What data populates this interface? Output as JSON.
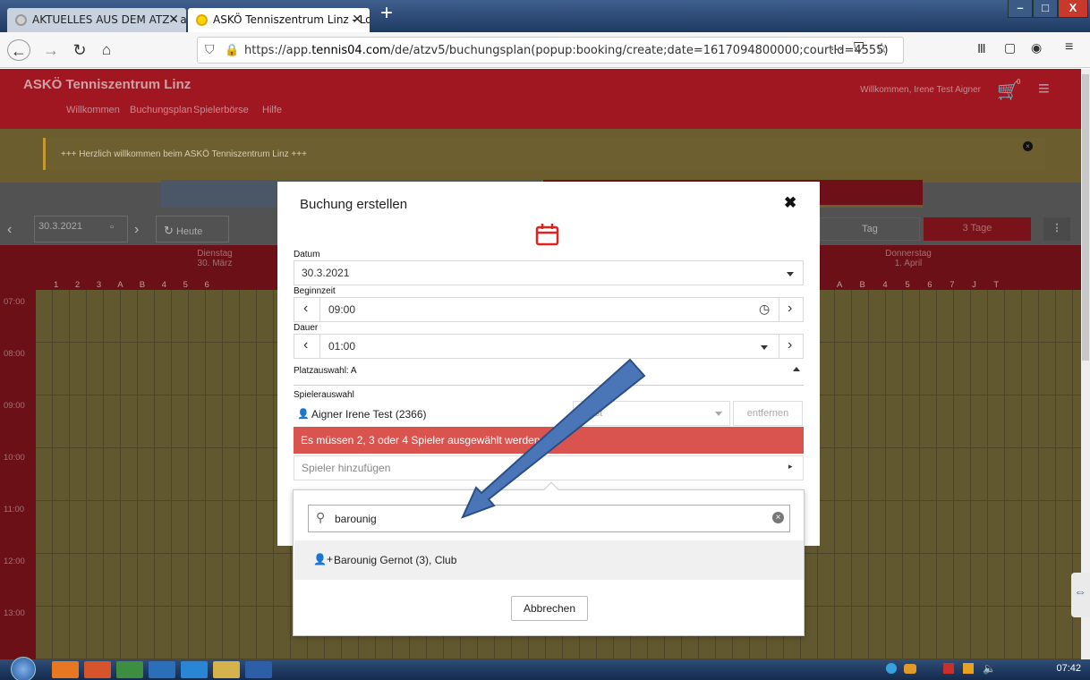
{
  "browser": {
    "tabs": [
      {
        "label": "AKTUELLES AUS DEM ATZ - at"
      },
      {
        "label": "ASKÖ Tenniszentrum Linz - Log"
      }
    ],
    "url_prefix": "https://app.",
    "url_domain": "tennis04.com",
    "url_path": "/de/atzv5/buchungsplan(popup:booking/create;date=1617094800000;courtId=4555)",
    "url_dots": "···"
  },
  "app": {
    "title": "ASKÖ Tenniszentrum Linz",
    "nav": [
      "Willkommen",
      "Buchungsplan",
      "Spielerbörse",
      "Hilfe"
    ],
    "welcome": "Willkommen, Irene Test Aigner",
    "cart_count": "0",
    "info_text": "+++ Herzlich willkommen beim ASKÖ Tenniszentrum Linz +++",
    "date_input": "30.3.2021",
    "today_btn": "Heute",
    "view_tag": "Tag",
    "view_3days": "3 Tage",
    "day_left": {
      "name": "Dienstag",
      "date": "30. März"
    },
    "day_right": {
      "name": "Donnerstag",
      "date": "1. April"
    },
    "courts_left": "1 2 3 A B 4 5 6",
    "courts_right": "A B 4 5 6 7 J T",
    "hours": [
      "07:00",
      "08:00",
      "09:00",
      "10:00",
      "11:00",
      "12:00",
      "13:00"
    ]
  },
  "modal": {
    "title": "Buchung erstellen",
    "close": "✖",
    "datum_label": "Datum",
    "datum_value": "30.3.2021",
    "beginn_label": "Beginnzeit",
    "beginn_value": "09:00",
    "dauer_label": "Dauer",
    "dauer_value": "01:00",
    "platz": "Platzauswahl: A",
    "spieler_label": "Spielerauswahl",
    "spieler_value": "Aigner Irene Test (2366)",
    "spieler_type": "Test",
    "remove_btn": "entfernen",
    "error": "Es müssen 2, 3 oder 4 Spieler ausgewählt werden.",
    "add_player": "Spieler hinzufügen"
  },
  "dropdown": {
    "search_value": "barounig",
    "result": "Barounig Gernot (3), Club",
    "cancel": "Abbrechen"
  },
  "taskbar": {
    "clock": "07:42"
  },
  "colors": {
    "brand_red": "#a01722",
    "error_red": "#d9534f",
    "arrow_blue": "#4a76b8"
  }
}
